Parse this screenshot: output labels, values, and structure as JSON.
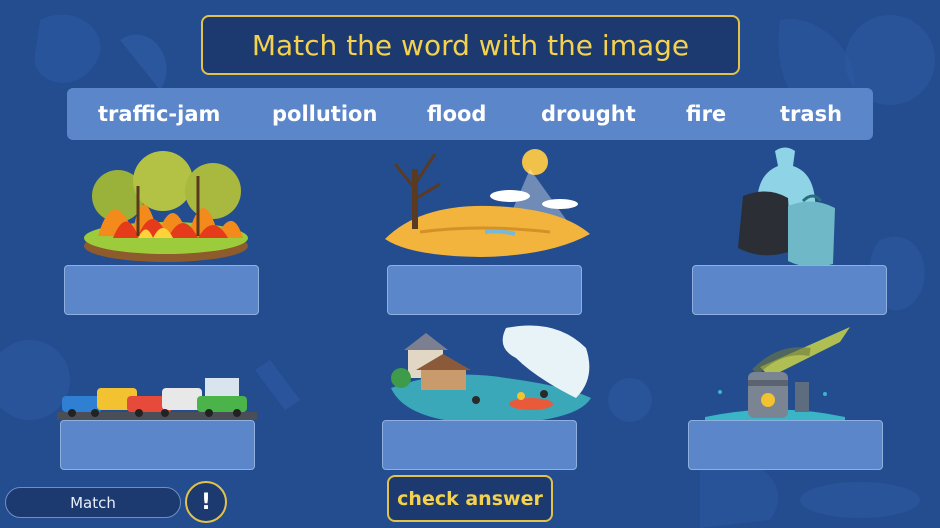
{
  "title": "Match the word with the image",
  "words": [
    "traffic-jam",
    "pollution",
    "flood",
    "drought",
    "fire",
    "trash"
  ],
  "images": [
    {
      "name": "wildfire-image"
    },
    {
      "name": "drought-image"
    },
    {
      "name": "trash-bags-image"
    },
    {
      "name": "traffic-jam-image"
    },
    {
      "name": "flood-image"
    },
    {
      "name": "pollution-image"
    }
  ],
  "footer": {
    "match_label": "Match",
    "info_label": "!",
    "check_label": "check answer"
  },
  "colors": {
    "background": "#234d8f",
    "panel": "#5b86c9",
    "accent": "#f4d24d"
  }
}
